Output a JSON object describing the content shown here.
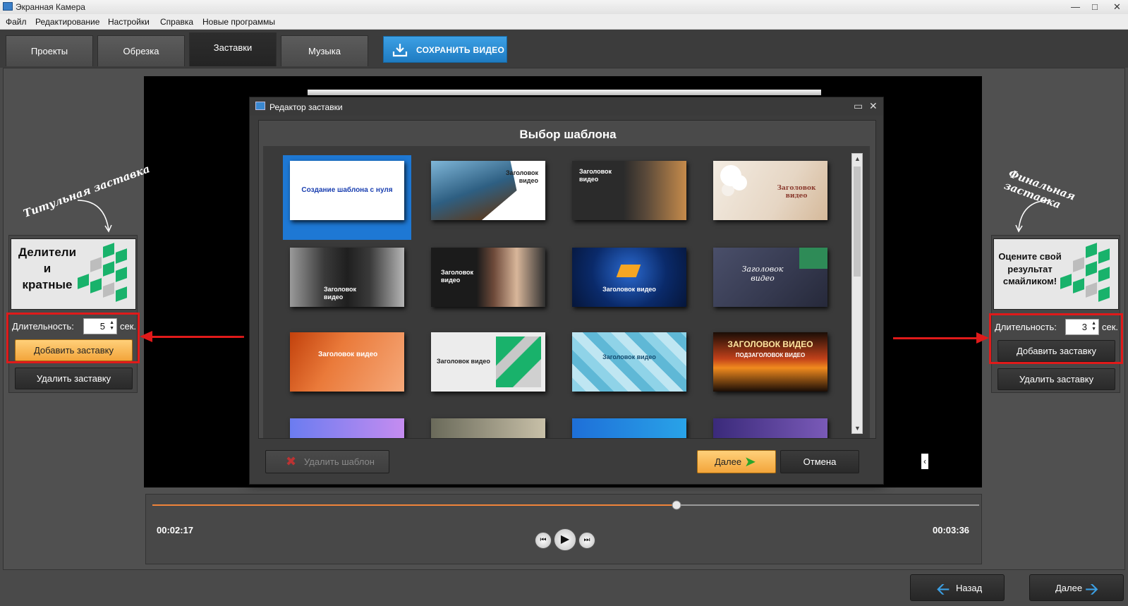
{
  "window": {
    "title": "Экранная Камера"
  },
  "menu": [
    "Файл",
    "Редактирование",
    "Настройки",
    "Справка",
    "Новые программы"
  ],
  "tabs": [
    "Проекты",
    "Обрезка",
    "Заставки",
    "Музыка"
  ],
  "active_tab": "Заставки",
  "save_button": "СОХРАНИТЬ ВИДЕО",
  "left_panel": {
    "caption": "Титульная заставка",
    "thumb_text": [
      "Делители",
      "и",
      "кратные"
    ],
    "duration_label": "Длительность:",
    "duration_value": "5",
    "duration_unit": "сек.",
    "add_button": "Добавить заставку",
    "remove_button": "Удалить заставку"
  },
  "right_panel": {
    "caption": "Финальная заставка",
    "thumb_text": [
      "Оцените свой",
      "результат",
      "смайликом!"
    ],
    "duration_label": "Длительность:",
    "duration_value": "3",
    "duration_unit": "сек.",
    "add_button": "Добавить заставку",
    "remove_button": "Удалить заставку"
  },
  "dialog": {
    "title": "Редактор заставки",
    "heading": "Выбор шаблона",
    "templates": [
      {
        "caption": "Создание шаблона с нуля"
      },
      {
        "caption": "Заголовок видео"
      },
      {
        "caption": "Заголовок видео"
      },
      {
        "caption": "Заголовок видео"
      },
      {
        "caption": "Заголовок видео"
      },
      {
        "caption": "Заголовок видео"
      },
      {
        "caption": "Заголовок видео"
      },
      {
        "caption": "Заголовок видео"
      },
      {
        "caption": "Заголовок видео"
      },
      {
        "caption": "Заголовок видео"
      },
      {
        "caption": "Заголовок видео"
      },
      {
        "caption": "ЗАГОЛОВОК ВИДЕО",
        "subcaption": "ПОДЗАГОЛОВОК ВИДЕО"
      }
    ],
    "delete_template": "Удалить шаблон",
    "next": "Далее",
    "cancel": "Отмена"
  },
  "player": {
    "current_time": "00:02:17",
    "total_time": "00:03:36",
    "progress": 0.634
  },
  "footer": {
    "back": "Назад",
    "next": "Далее"
  },
  "colors": {
    "accent_blue": "#2a8bd6",
    "accent_orange": "#f3a53b",
    "highlight_red": "#e01a1a",
    "cube_green": "#19b26b"
  }
}
